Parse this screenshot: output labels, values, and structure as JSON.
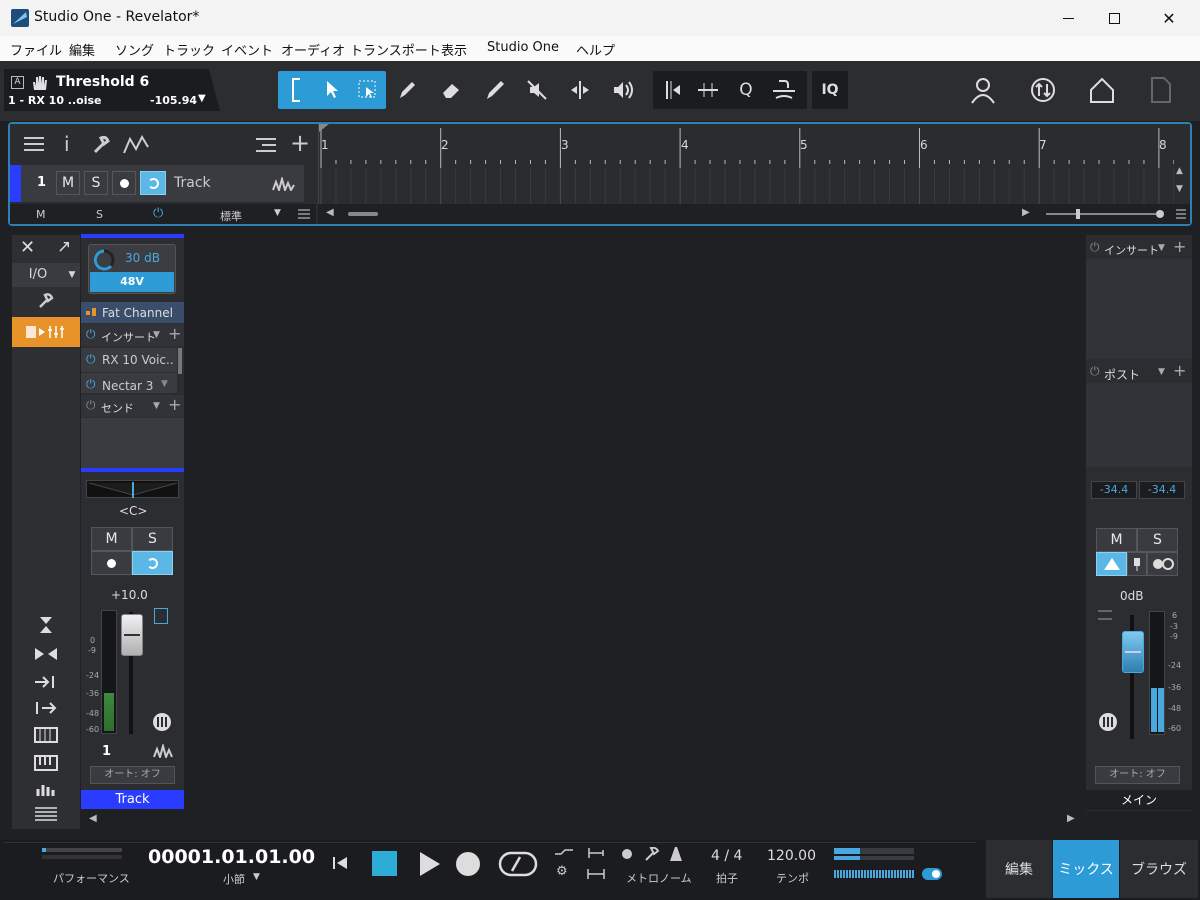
{
  "window": {
    "title": "Studio One - Revelator*"
  },
  "menu": [
    "ファイル",
    "編集",
    "ソング",
    "トラック",
    "イベント",
    "オーディオ",
    "トランスポート",
    "表示",
    "Studio One",
    "ヘルプ"
  ],
  "info": {
    "label_a": "A",
    "title": "Threshold 6",
    "device": "1 - RX 10 ..oise",
    "value": "-105.94"
  },
  "tools": {
    "iq": "IQ"
  },
  "arrange": {
    "ruler": [
      "1",
      "2",
      "3",
      "4",
      "5",
      "6",
      "7",
      "8"
    ],
    "track": {
      "number": "1",
      "mute": "M",
      "solo": "S",
      "name": "Track"
    },
    "footer": {
      "m": "M",
      "s": "S",
      "mode": "標準"
    }
  },
  "left_panel": {
    "io_label": "I/O"
  },
  "channel": {
    "gain": "30 dB",
    "phantom": "48V",
    "fat_channel": "Fat Channel",
    "insert_label": "インサート",
    "inserts": [
      "RX 10 Voic..",
      "Nectar 3"
    ],
    "send_label": "センド",
    "pan": "<C>",
    "mute": "M",
    "solo": "S",
    "volume": "+10.0",
    "meter_scale": [
      "0",
      "-9",
      "-24",
      "-36",
      "-48",
      "-60"
    ],
    "number": "1",
    "auto": "オート: オフ",
    "name": "Track"
  },
  "main_channel": {
    "insert_label": "インサート",
    "post_label": "ポスト",
    "peak_l": "-34.4",
    "peak_r": "-34.4",
    "mute": "M",
    "solo": "S",
    "volume": "0dB",
    "meter_scale": [
      "6",
      "-3",
      "-9",
      "-24",
      "-36",
      "-48",
      "-60"
    ],
    "auto": "オート: オフ",
    "name": "メイン"
  },
  "transport": {
    "performance": "パフォーマンス",
    "position": "00001.01.01.00",
    "position_unit": "小節",
    "metronome": "メトロノーム",
    "signature": "4 / 4",
    "signature_label": "拍子",
    "tempo": "120.00",
    "tempo_label": "テンポ"
  },
  "nav": {
    "edit": "編集",
    "mix": "ミックス",
    "browse": "ブラウズ"
  },
  "colors": {
    "accent": "#2d9bd6",
    "track": "#2a3cff",
    "orange": "#e8922a"
  }
}
